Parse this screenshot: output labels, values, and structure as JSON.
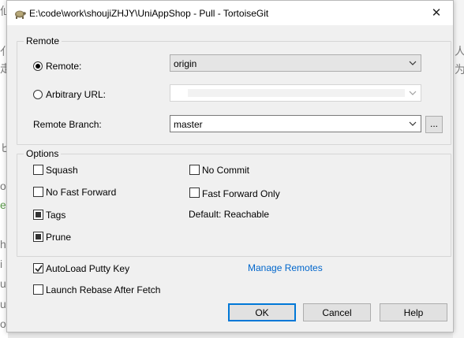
{
  "window": {
    "title": "E:\\code\\work\\shoujiZHJY\\UniAppShop - Pull - TortoiseGit",
    "close_glyph": "✕"
  },
  "remote_group": {
    "legend": "Remote",
    "remote_label": "Remote:",
    "remote_value": "origin",
    "arbitrary_label": "Arbitrary URL:",
    "arbitrary_value": "",
    "branch_label": "Remote Branch:",
    "branch_value": "master",
    "browse_label": "..."
  },
  "options_group": {
    "legend": "Options",
    "squash": "Squash",
    "no_commit": "No Commit",
    "no_fast_forward": "No Fast Forward",
    "fast_forward_only": "Fast Forward Only",
    "tags": "Tags",
    "default_reachable": "Default: Reachable",
    "prune": "Prune"
  },
  "autoload_putty_key": "AutoLoad Putty Key",
  "launch_rebase": "Launch Rebase After Fetch",
  "manage_remotes": "Manage Remotes",
  "buttons": {
    "ok": "OK",
    "cancel": "Cancel",
    "help": "Help"
  },
  "colors": {
    "link": "#0066cc",
    "default_button_border": "#0078d7",
    "dialog_bg": "#f0f0f0"
  }
}
